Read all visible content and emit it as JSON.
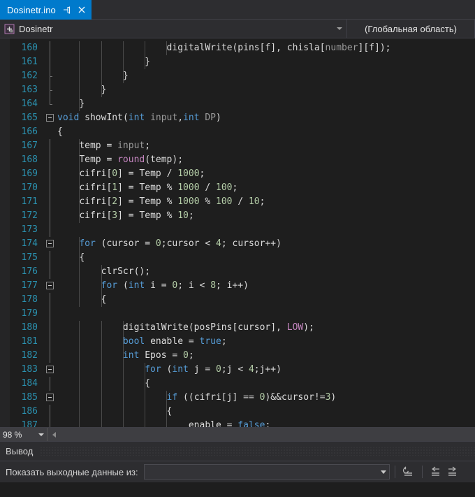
{
  "tab": {
    "label": "Dosinetr.ino",
    "pin_icon": "pin-icon",
    "close_icon": "close-icon"
  },
  "navbar": {
    "project_icon": "project-icon",
    "project_name": "Dosinetr",
    "scope": "(Глобальная область)"
  },
  "editor": {
    "first_line_number": 160,
    "lines": [
      {
        "n": 160,
        "fold": "line",
        "text": "                    digitalWrite(pins[f], chisla[number][f]);"
      },
      {
        "n": 161,
        "fold": "line",
        "text": "                }"
      },
      {
        "n": 162,
        "fold": "tick",
        "text": "            }"
      },
      {
        "n": 163,
        "fold": "tick",
        "text": "        }"
      },
      {
        "n": 164,
        "fold": "end",
        "text": "    }"
      },
      {
        "n": 165,
        "fold": "box",
        "text": "void showInt(int input,int DP)"
      },
      {
        "n": 166,
        "fold": "none",
        "text": "{"
      },
      {
        "n": 167,
        "fold": "line",
        "text": "    temp = input;"
      },
      {
        "n": 168,
        "fold": "line",
        "text": "    Temp = round(temp);"
      },
      {
        "n": 169,
        "fold": "line",
        "text": "    cifri[0] = Temp / 1000;"
      },
      {
        "n": 170,
        "fold": "line",
        "text": "    cifri[1] = Temp % 1000 / 100;"
      },
      {
        "n": 171,
        "fold": "line",
        "text": "    cifri[2] = Temp % 1000 % 100 / 10;"
      },
      {
        "n": 172,
        "fold": "line",
        "text": "    cifri[3] = Temp % 10;"
      },
      {
        "n": 173,
        "fold": "line",
        "text": ""
      },
      {
        "n": 174,
        "fold": "box",
        "text": "    for (cursor = 0;cursor < 4; cursor++)"
      },
      {
        "n": 175,
        "fold": "line",
        "text": "    {"
      },
      {
        "n": 176,
        "fold": "line",
        "text": "        clrScr();"
      },
      {
        "n": 177,
        "fold": "box",
        "text": "        for (int i = 0; i < 8; i++)"
      },
      {
        "n": 178,
        "fold": "line",
        "text": "        {"
      },
      {
        "n": 179,
        "fold": "line",
        "text": ""
      },
      {
        "n": 180,
        "fold": "line",
        "text": "            digitalWrite(posPins[cursor], LOW);"
      },
      {
        "n": 181,
        "fold": "line",
        "text": "            bool enable = true;"
      },
      {
        "n": 182,
        "fold": "line",
        "text": "            int Epos = 0;"
      },
      {
        "n": 183,
        "fold": "box",
        "text": "                for (int j = 0;j < 4;j++)"
      },
      {
        "n": 184,
        "fold": "line",
        "text": "                {"
      },
      {
        "n": 185,
        "fold": "box",
        "text": "                    if ((cifri[j] == 0)&&cursor!=3)"
      },
      {
        "n": 186,
        "fold": "line",
        "text": "                    {"
      },
      {
        "n": 187,
        "fold": "line",
        "text": "                        enable = false;"
      }
    ],
    "tokens": {
      "keywords": [
        "void",
        "int",
        "for",
        "if",
        "bool",
        "true",
        "false"
      ],
      "macros": [
        "LOW",
        "round"
      ],
      "parameters": [
        "input",
        "DP",
        "number"
      ]
    }
  },
  "statusbar": {
    "zoom_level": "98 %",
    "scroll_left_icon": "scroll-left-icon"
  },
  "output": {
    "title": "Вывод",
    "source_label": "Показать выходные данные из:",
    "source_value": "",
    "buttons": [
      {
        "name": "clear-all-button",
        "icon": "clear-all-icon"
      },
      {
        "name": "go-to-previous-message-button",
        "icon": "arrow-left-icon"
      },
      {
        "name": "go-to-next-message-button",
        "icon": "arrow-right-icon"
      }
    ]
  },
  "colors": {
    "tab_active": "#007acc",
    "chrome": "#2d2d30",
    "editor_bg": "#1e1e1e",
    "line_number": "#2b91af",
    "keyword": "#569cd6",
    "string_number": "#b5cea8",
    "macro": "#c586c0",
    "parameter": "#9b9b9b",
    "plain_text": "#dcdcdc"
  }
}
